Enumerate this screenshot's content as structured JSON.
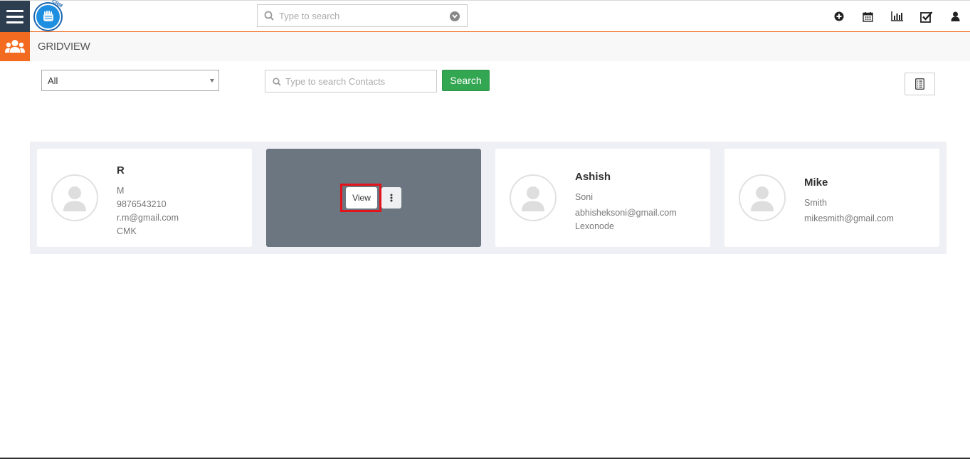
{
  "header": {
    "logo_text": "CRM",
    "search_placeholder": "Type to search",
    "icons": [
      "add-circle-icon",
      "calendar-icon",
      "bar-chart-icon",
      "checkbox-icon",
      "user-icon"
    ]
  },
  "subheader": {
    "title": "GRIDVIEW",
    "icon": "users-group-icon"
  },
  "filters": {
    "select_value": "All",
    "search_placeholder": "Type to search Contacts",
    "search_button": "Search",
    "list_view_icon": "list-icon"
  },
  "cards": [
    {
      "name": "R",
      "lines": [
        "M",
        "9876543210",
        "r.m@gmail.com",
        "CMK"
      ]
    },
    {
      "hover": true,
      "view_label": "View"
    },
    {
      "name": "Ashish",
      "lines": [
        "Soni",
        "abhisheksoni@gmail.com",
        "Lexonode"
      ]
    },
    {
      "name": "Mike",
      "lines": [
        "Smith",
        "mikesmith@gmail.com"
      ]
    }
  ],
  "colors": {
    "accent": "#f26b21",
    "nav": "#2d3e50",
    "search_button": "#33a652",
    "hover_card": "#6b7680",
    "highlight": "#e3131b"
  }
}
